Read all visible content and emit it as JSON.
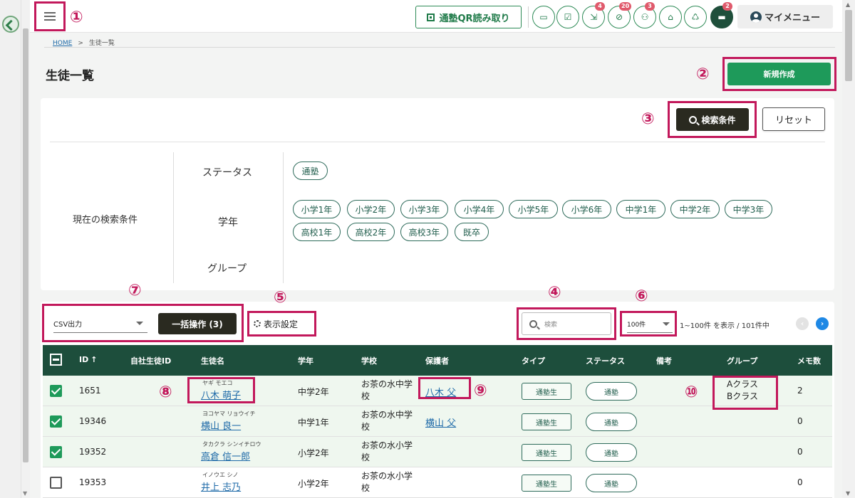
{
  "annotations": {
    "n1": "①",
    "n2": "②",
    "n3": "③",
    "n4": "④",
    "n5": "⑤",
    "n6": "⑥",
    "n7": "⑦",
    "n8": "⑧",
    "n9": "⑨",
    "n10": "⑩"
  },
  "topbar": {
    "qr_label": "通塾QR読み取り",
    "icons": [
      {
        "name": "message-icon",
        "badge": ""
      },
      {
        "name": "checklist-icon",
        "badge": ""
      },
      {
        "name": "compress-arrows-icon",
        "badge": "4"
      },
      {
        "name": "clock-off-icon",
        "badge": "20"
      },
      {
        "name": "group-icon",
        "badge": "3"
      },
      {
        "name": "school-icon",
        "badge": ""
      },
      {
        "name": "gift-icon",
        "badge": ""
      },
      {
        "name": "chat-icon",
        "badge": "2"
      }
    ],
    "mymenu_label": "マイメニュー"
  },
  "breadcrumb": {
    "home": "HOME",
    "sep": ">",
    "current": "生徒一覧"
  },
  "page": {
    "title": "生徒一覧",
    "new_button": "新規作成"
  },
  "search": {
    "search_button": "検索条件",
    "reset_button": "リセット",
    "current_label": "現在の検索条件",
    "keys": {
      "status": "ステータス",
      "grade": "学年",
      "group": "グループ"
    },
    "status_chips": [
      "通塾"
    ],
    "grade_chips_row1": [
      "小学1年",
      "小学2年",
      "小学3年",
      "小学4年",
      "小学5年",
      "小学6年",
      "中学1年",
      "中学2年",
      "中学3年"
    ],
    "grade_chips_row2": [
      "高校1年",
      "高校2年",
      "高校3年",
      "既卒"
    ]
  },
  "toolbar": {
    "csv_select": "CSV出力",
    "bulk_button": "一括操作 (3)",
    "display_settings": "表示設定",
    "keyword_placeholder": "検索",
    "per_page": "100件",
    "count_text": "1~100件 を表示 / 101件中"
  },
  "table": {
    "headers": {
      "id": "ID",
      "id_sort": "↑",
      "own_id": "自社生徒ID",
      "name": "生徒名",
      "grade": "学年",
      "school": "学校",
      "guardian": "保護者",
      "type": "タイプ",
      "status": "ステータス",
      "note": "備考",
      "group": "グループ",
      "memo": "メモ数"
    },
    "rows": [
      {
        "checked": true,
        "id": "1651",
        "kana": "ヤギ モエコ",
        "name": "八木 萌子",
        "grade": "中学2年",
        "school_l1": "お茶の水中学",
        "school_l2": "校",
        "guardian": "八木 父",
        "type": "通塾生",
        "status": "通塾",
        "group_l1": "Aクラス",
        "group_l2": "Bクラス",
        "memo": "2"
      },
      {
        "checked": true,
        "id": "19346",
        "kana": "ヨコヤマ リョウイチ",
        "name": "横山 良一",
        "grade": "中学1年",
        "school_l1": "お茶の水中学",
        "school_l2": "校",
        "guardian": "横山 父",
        "type": "通塾生",
        "status": "通塾",
        "group_l1": "",
        "group_l2": "",
        "memo": "0"
      },
      {
        "checked": true,
        "id": "19352",
        "kana": "タカクラ シンイチロウ",
        "name": "高倉 信一郎",
        "grade": "小学2年",
        "school_l1": "お茶の水小学",
        "school_l2": "校",
        "guardian": "",
        "type": "通塾生",
        "status": "通塾",
        "group_l1": "",
        "group_l2": "",
        "memo": "0"
      },
      {
        "checked": false,
        "id": "19353",
        "kana": "イノウエ シノ",
        "name": "井上 志乃",
        "grade": "小学2年",
        "school_l1": "お茶の水小学",
        "school_l2": "校",
        "guardian": "",
        "type": "通塾生",
        "status": "通塾",
        "group_l1": "",
        "group_l2": "",
        "memo": "0"
      }
    ]
  },
  "colors": {
    "accent": "#1e9a5a",
    "header_bg": "#1d4e3c",
    "annotation": "#c2185b",
    "link": "#1e6aa8"
  }
}
